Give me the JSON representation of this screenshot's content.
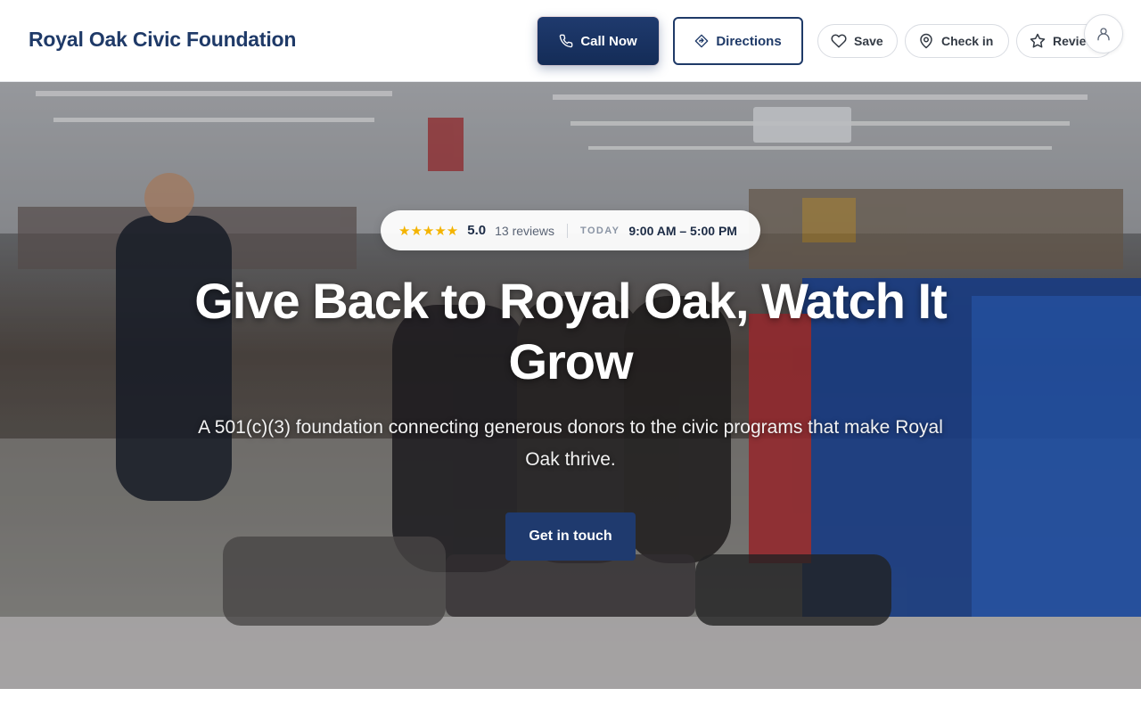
{
  "header": {
    "brand": "Royal Oak Civic Foundation",
    "call_label": "Call Now",
    "directions_label": "Directions",
    "save_label": "Save",
    "checkin_label": "Check in",
    "review_label": "Review"
  },
  "hero": {
    "stars": "★★★★★",
    "rating": "5.0",
    "reviews": "13 reviews",
    "today_label": "TODAY",
    "hours": "9:00 AM – 5:00 PM",
    "title": "Give Back to Royal Oak, Watch It Grow",
    "subtitle": "A 501(c)(3) foundation connecting generous donors to the civic programs that make Royal Oak thrive.",
    "cta_label": "Get in touch"
  },
  "colors": {
    "brand": "#1f3a68",
    "primary_button": "#1f3a6e",
    "star": "#f4b400"
  },
  "icons": {
    "call": "phone-icon",
    "directions": "directions-icon",
    "save": "heart-icon",
    "checkin": "map-pin-icon",
    "review": "star-icon",
    "account": "user-icon"
  }
}
